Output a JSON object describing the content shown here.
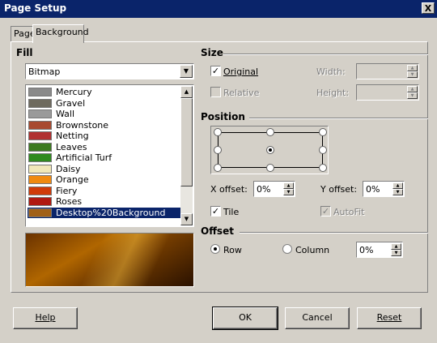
{
  "window": {
    "title": "Page Setup",
    "close_label": "X"
  },
  "tabs": [
    {
      "label": "Page"
    },
    {
      "label": "Background"
    }
  ],
  "fill": {
    "section_label": "Fill",
    "type_selected": "Bitmap",
    "bitmaps": [
      {
        "label": "Mercury",
        "color": "#8a8a8a"
      },
      {
        "label": "Gravel",
        "color": "#6e6a5e"
      },
      {
        "label": "Wall",
        "color": "#9a9a9a"
      },
      {
        "label": "Brownstone",
        "color": "#a84a30"
      },
      {
        "label": "Netting",
        "color": "#b03030"
      },
      {
        "label": "Leaves",
        "color": "#3c7a20"
      },
      {
        "label": "Artificial Turf",
        "color": "#2f8a1e"
      },
      {
        "label": "Daisy",
        "color": "#f0e8b8"
      },
      {
        "label": "Orange",
        "color": "#f08a10"
      },
      {
        "label": "Fiery",
        "color": "#d03a08"
      },
      {
        "label": "Roses",
        "color": "#b01810"
      },
      {
        "label": "Desktop%20Background",
        "color": "#a06018"
      }
    ],
    "selected_index": 11
  },
  "size": {
    "section_label": "Size",
    "original_label": "Original",
    "original_checked": true,
    "relative_label": "Relative",
    "relative_checked": false,
    "width_label": "Width:",
    "width_value": "",
    "height_label": "Height:",
    "height_value": ""
  },
  "position": {
    "section_label": "Position",
    "selected": "center",
    "x_offset_label": "X offset:",
    "x_offset_value": "0%",
    "y_offset_label": "Y offset:",
    "y_offset_value": "0%",
    "tile_label": "Tile",
    "tile_checked": true,
    "autofit_label": "AutoFit",
    "autofit_checked": true
  },
  "offset": {
    "section_label": "Offset",
    "row_label": "Row",
    "column_label": "Column",
    "selected": "row",
    "value": "0%"
  },
  "buttons": {
    "help": "Help",
    "ok": "OK",
    "cancel": "Cancel",
    "reset": "Reset"
  }
}
